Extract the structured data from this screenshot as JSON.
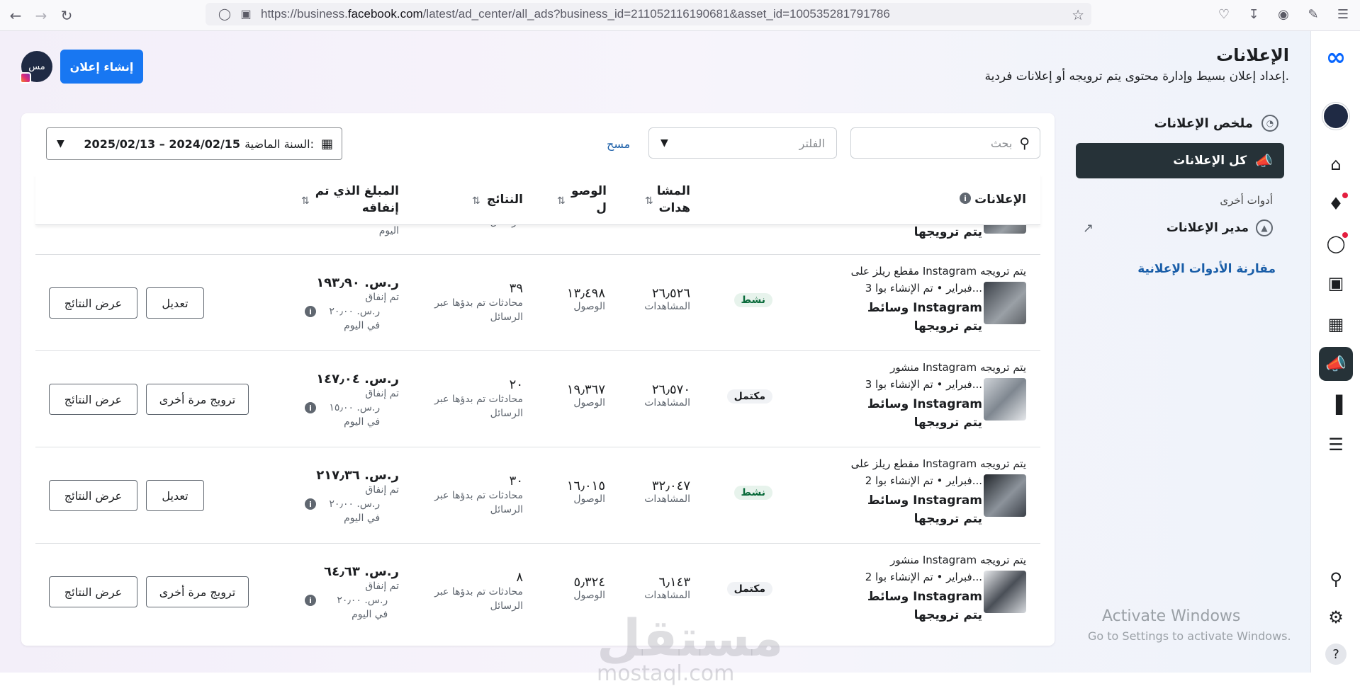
{
  "browser": {
    "url_prefix": "https://business.",
    "url_host": "facebook.com",
    "url_path": "/latest/ad_center/all_ads?business_id=211052116190681&asset_id=100535281791786"
  },
  "header": {
    "title": "الإعلانات",
    "subtitle": "إعداد إعلان بسيط وإدارة محتوى يتم ترويجه أو إعلانات فردية.",
    "create_button": "إنشاء إعلان",
    "avatar_text": "مس"
  },
  "sidenav": {
    "summary": "ملخص الإعلانات",
    "all_ads": "كل الإعلانات",
    "other_tools": "أدوات أخرى",
    "ads_manager": "مدير الإعلانات",
    "compare": "مقارنة الأدوات الإعلانية"
  },
  "toolbar": {
    "search_placeholder": "بحث",
    "filter_placeholder": "الفلتر",
    "clear": "مسح",
    "date_label": "السنة الماضية:",
    "date_range": "2025/02/13 – 2024/02/15"
  },
  "table": {
    "headers": {
      "ads": "الإعلانات",
      "views": "المشا هدات",
      "reach": "الوصو ل",
      "results": "النتائج",
      "spend": "المبلغ الذي تم إنفاقه"
    },
    "partial_row": {
      "name": "يتم ترويجها",
      "spend_sub": "اليوم",
      "results_sub": "الرسائل"
    },
    "rows": [
      {
        "type": "مقطع ريلز على Instagram يتم ترويجه",
        "meta": "3 فبراير • تم الإنشاء بوا...",
        "name": "وسائط Instagram يتم ترويجها",
        "status": "نشط",
        "views": "٢٦٫٥٢٦",
        "views_label": "المشاهدات",
        "reach": "١٣٫٤٩٨",
        "reach_label": "الوصول",
        "results": "٣٩",
        "results_label": "محادثات تم بدؤها عبر الرسائل",
        "spend": "ر.س. ١٩٣٫٩٠",
        "spend_label": "تم إنفاق",
        "spend_daily": "ر.س. ٢٠٫٠٠ في اليوم",
        "action": "تعديل",
        "view_results": "عرض النتائج"
      },
      {
        "type": "منشور Instagram يتم ترويجه",
        "meta": "3 فبراير • تم الإنشاء بوا...",
        "name": "وسائط Instagram يتم ترويجها",
        "status": "مكتمل",
        "views": "٢٦٫٥٧٠",
        "views_label": "المشاهدات",
        "reach": "١٩٫٣٦٧",
        "reach_label": "الوصول",
        "results": "٢٠",
        "results_label": "محادثات تم بدؤها عبر الرسائل",
        "spend": "ر.س. ١٤٧٫٠٤",
        "spend_label": "تم إنفاق",
        "spend_daily": "ر.س. ١٥٫٠٠ في اليوم",
        "action": "ترويج مرة أخرى",
        "view_results": "عرض النتائج"
      },
      {
        "type": "مقطع ريلز على Instagram يتم ترويجه",
        "meta": "2 فبراير • تم الإنشاء بوا...",
        "name": "وسائط Instagram يتم ترويجها",
        "status": "نشط",
        "views": "٣٢٫٠٤٧",
        "views_label": "المشاهدات",
        "reach": "١٦٫٠١٥",
        "reach_label": "الوصول",
        "results": "٣٠",
        "results_label": "محادثات تم بدؤها عبر الرسائل",
        "spend": "ر.س. ٢١٧٫٣٦",
        "spend_label": "تم إنفاق",
        "spend_daily": "ر.س. ٢٠٫٠٠ في اليوم",
        "action": "تعديل",
        "view_results": "عرض النتائج"
      },
      {
        "type": "منشور Instagram يتم ترويجه",
        "meta": "2 فبراير • تم الإنشاء بوا...",
        "name": "وسائط Instagram يتم ترويجها",
        "status": "مكتمل",
        "views": "٦٫١٤٣",
        "views_label": "المشاهدات",
        "reach": "٥٫٣٢٤",
        "reach_label": "الوصول",
        "results": "٨",
        "results_label": "محادثات تم بدؤها عبر الرسائل",
        "spend": "ر.س. ٦٤٫٦٣",
        "spend_label": "تم إنفاق",
        "spend_daily": "ر.س. ٢٠٫٠٠ في اليوم",
        "action": "ترويج مرة أخرى",
        "view_results": "عرض النتائج"
      }
    ]
  },
  "overlay": {
    "activate_title": "Activate Windows",
    "activate_sub": "Go to Settings to activate Windows.",
    "wm_logo": "مستقل",
    "wm_url": "mostaql.com"
  }
}
